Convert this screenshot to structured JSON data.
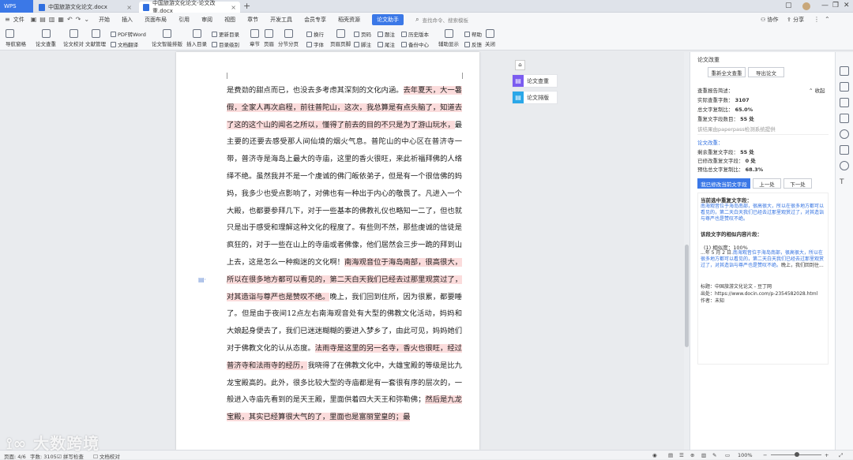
{
  "titlebar": {
    "app_label": "WPS",
    "tabs": [
      {
        "label": "中国旅游文化论文.docx"
      },
      {
        "label": "中国旅游文化论文-论文改重.docx"
      }
    ]
  },
  "menubar": {
    "file": "文件",
    "items": [
      "开始",
      "插入",
      "页面布局",
      "引用",
      "审阅",
      "视图",
      "章节",
      "开发工具",
      "会员专享",
      "稻壳资源",
      "论文助手"
    ],
    "search_placeholder": "查找命令、搜索模板",
    "collab": "协作",
    "share": "分享"
  },
  "ribbon": {
    "nav_pane": "导航窗格",
    "check": "论文查重",
    "proofread": "论文校对",
    "doc_manage": "文献管理",
    "pdf_word": "PDF转Word",
    "translate": "文档翻译",
    "layout": "论文智能排版",
    "insert_toc": "插入目录",
    "update_toc": "更新目录",
    "toc_level": "目录级别",
    "chapter": "章节",
    "page": "页眉",
    "section": "分节分页",
    "line_break": "换行",
    "font": "字体",
    "page_border": "页眉页脚",
    "footnote": "脚注",
    "page_num": "页码",
    "caption": "题注",
    "endnote": "尾注",
    "history": "历史版本",
    "backup": "备份中心",
    "aux": "辅助显示",
    "help": "帮助",
    "feedback": "反馈",
    "close": "关闭"
  },
  "document": {
    "lines": [
      {
        "t": "是费劲的甜点而已，也没去多考虑其深刻的文化内涵。",
        "h": false
      },
      {
        "t": "去年夏天，大一暑假，全家人再次启程，前往普陀山，这次，我总算是有点头脑了，知道去了这的这个山的闻名之所以，懂得了前去的目的不只是为了游山玩水，",
        "h": true
      },
      {
        "t": "最主要的还要去感受那人间仙境的烟火气息。普陀山的中心区在普济寺一带，普济寺是海岛上最大的寺庙，这里的香火很旺，来此祈福拜佛的人络绎不绝。虽然我并不是一个虔诚的佛门皈依弟子，但是有一个很信佛的妈妈，我多少也受点影响了，对佛也有一种出于内心的敬畏了。凡进入一个大殿，也都要参拜几下，对于一些基本的佛教礼仪也略知一二了，但也就只是出于感受和理解这种文化的程度了。有些则不然，那些虔诚的信徒是疯狂的，对于一些在山上的寺庙或者佛像，他们居然会三步一跪的拜到山上去，这是怎么一种痴迷的文化啊！",
        "h": false
      },
      {
        "t": "南海观音位于海岛南部，很高很大，所以在很多地方都可以看见的，第二天白天我们已经去过那里观赏过了，对其造诣与尊严也是赞叹不绝。",
        "h": true
      },
      {
        "t": "晚上，我们回到住所，因为很累，都要睡了。但是由于夜间12点左右南海观音处有大型的佛教文化活动，妈妈和大娘起身便去了，我们已迷迷糊糊的要进入梦乡了，由此可见，妈妈她们对于佛教文化的认从态度。",
        "h": false
      },
      {
        "t": "法雨寺是这里的另一名寺，香火也很旺，经过普济寺和法雨寺的经历，",
        "h": true
      },
      {
        "t": "我晓得了在佛教文化中，大雄宝殿的等级是比九龙宝殿高的。此外，很多比较大型的寺庙都是有一套很有序的层次的，一般进入寺庙先看到的是天王殿，里面供着四大天王和弥勒佛；",
        "h": false
      },
      {
        "t": "然后是九龙宝殿，其实已经算很大气的了，里面也是富丽堂皇的；最",
        "h": true
      }
    ]
  },
  "float_buttons": {
    "check": "论文查重",
    "layout": "论文排版"
  },
  "panel": {
    "title": "论文改重",
    "recheck_btn": "重新全文查重",
    "export_btn": "导出论文",
    "report_title": "查重报告简述：",
    "collapse": "收起",
    "rows": [
      {
        "label": "实际查重字数：",
        "value": "3107"
      },
      {
        "label": "总文字复制比：",
        "value": "65.0%"
      },
      {
        "label": "重复文字段数目：",
        "value": "55 处"
      }
    ],
    "engine_note": "该结果由paperpass检测系统提供",
    "modify_title": "论文改重：",
    "mod_rows": [
      {
        "label": "剩余重复文字段：",
        "value": "55 处"
      },
      {
        "label": "已修改重复文字段：",
        "value": "0 处"
      },
      {
        "label": "预估总文字复制比：",
        "value": "68.3%"
      }
    ],
    "modify_btn": "我已修改当前文字段",
    "prev_btn": "上一处",
    "next_btn": "下一处",
    "current_title": "当前选中重复文字段：",
    "current_text": "南海观音位于海岛南部，很高很大，所以在很多地方都可以看见的，第二天白天我们已经去过那里观赏过了，对其造诣与尊严也是赞叹不绝。",
    "source_title": "该段文字的相似内容片段：",
    "similar_label": "(1) 相似度：100%",
    "source_prefix": "...年 5 月 2 日.",
    "source_text": "南海观音位于海岛南部，很高很大，所以在很多地方都可以看见的，第二天白天我们已经去过那里观赏过了，对其造诣与尊严也是赞叹不绝。",
    "source_suffix": "晚上，我们回到住...",
    "meta_title": "标题：中国旅游文化论文 - 豆丁网",
    "meta_source": "出处：https://www.docin.com/p-2354582028.html",
    "meta_author": "作者：未知"
  },
  "status": {
    "page": "页面: 4/6",
    "words": "字数: 3105",
    "spell": "拼写检查",
    "proof": "文档校对",
    "zoom": "100%"
  },
  "watermark": "大数跨境",
  "colors": {
    "accent": "#3b78e7",
    "highlight": "#fbdcdc",
    "link": "#2f6fe0"
  }
}
